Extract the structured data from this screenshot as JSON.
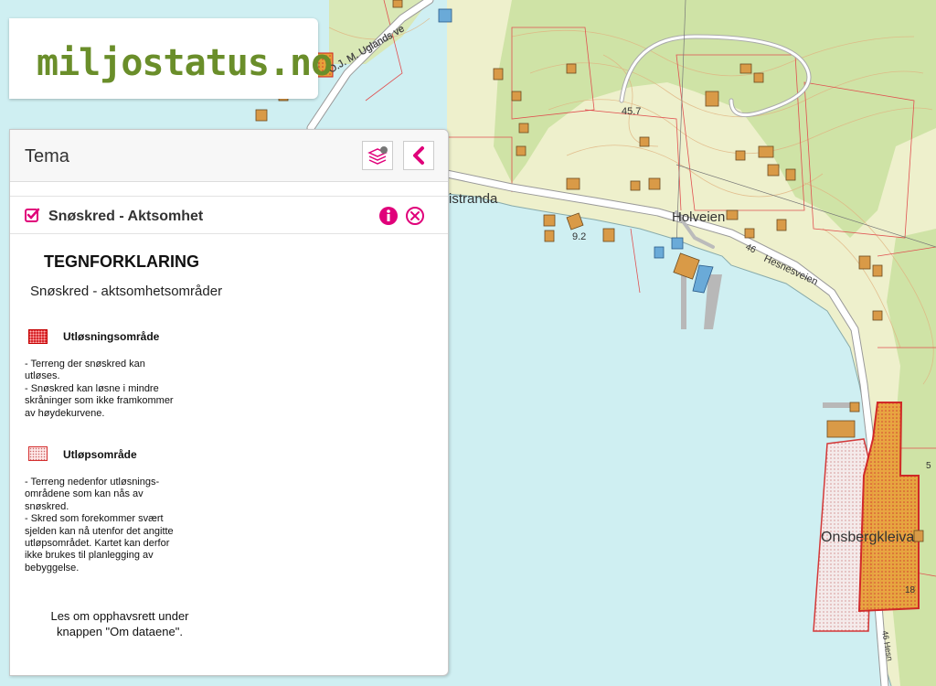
{
  "logo": {
    "text": "miljostatus.no"
  },
  "panel": {
    "title": "Tema",
    "layer": {
      "name": "Snøskred - Aktsomhet",
      "checked": true
    },
    "legend": {
      "title": "TEGNFORKLARING",
      "subtitle": "Snøskred - aktsomhetsområder",
      "items": [
        {
          "label": "Utløsningsområde",
          "color": "#d9292e",
          "description": "- Terreng der snøskred kan\nutløses.\n- Snøskred kan løsne i mindre\nskråninger som ikke framkommer\nav høydekurvene."
        },
        {
          "label": "Utløpsområde",
          "color": "#fde6e6",
          "description": "- Terreng nedenfor utløsnings-\nområdene som kan nås av\nsnøskred.\n- Skred som forekommer svært\nsjelden kan nå utenfor det angitte\nutløpsområdet. Kartet kan derfor\nikke brukes til planlegging av\nbebyggelse."
        }
      ],
      "footnote": "Les om opphavsrett under\nknappen \"Om dataene\"."
    }
  },
  "map": {
    "labels": {
      "road_ugland": "O.J. M. Uglands ve",
      "istranda": "istranda",
      "holveien": "Holveien",
      "hesnesveien": "Hesnesveien",
      "hesnesveien_num": "46",
      "elev_457": "45.7",
      "elev_92": "9.2",
      "onsbergkleiva": "Onsbergkleiva",
      "elev_18": "18",
      "hesn_bottom": "46 Hesn",
      "edge_5": "5"
    }
  },
  "colors": {
    "accent": "#e0007a",
    "logo_green": "#6a8e2a",
    "water": "#cfeff2",
    "land": "#eef0cc",
    "forest": "#cfe3a6"
  }
}
